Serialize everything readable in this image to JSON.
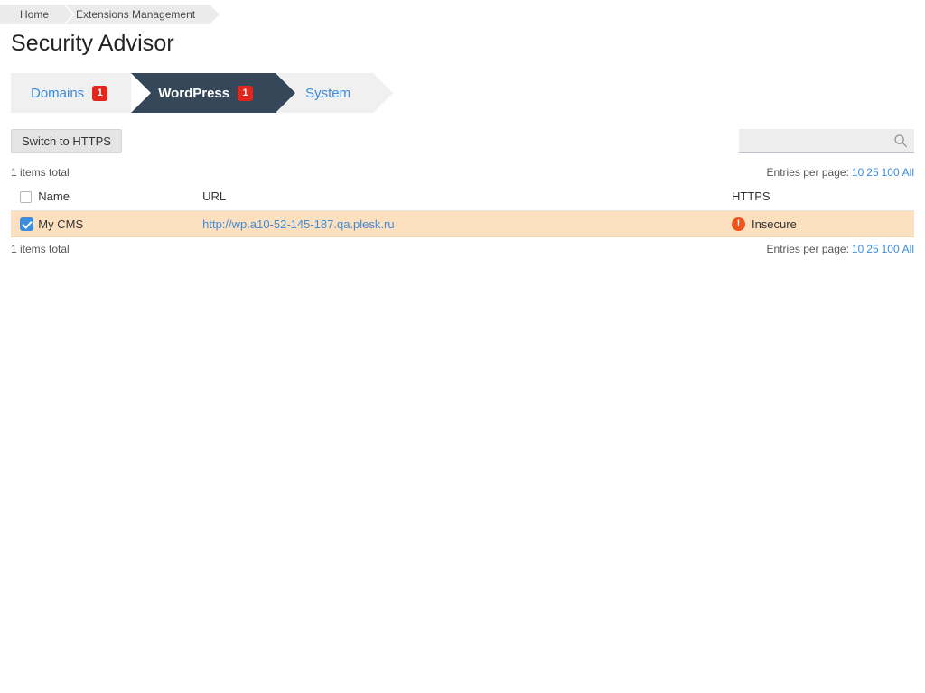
{
  "breadcrumb": {
    "items": [
      {
        "label": "Home"
      },
      {
        "label": "Extensions Management"
      }
    ]
  },
  "page": {
    "title": "Security Advisor"
  },
  "tabs": [
    {
      "label": "Domains",
      "badge": "1",
      "active": false
    },
    {
      "label": "WordPress",
      "badge": "1",
      "active": true
    },
    {
      "label": "System",
      "badge": "",
      "active": false
    }
  ],
  "toolbar": {
    "switch_https_label": "Switch to HTTPS",
    "search_placeholder": "",
    "search_value": "",
    "search_icon": "search-icon"
  },
  "pager": {
    "items_total": "1 items total",
    "entries_label": "Entries per page:",
    "options": [
      "10",
      "25",
      "100",
      "All"
    ]
  },
  "table": {
    "columns": {
      "name": "Name",
      "url": "URL",
      "https": "HTTPS"
    },
    "rows": [
      {
        "checked": true,
        "name": "My CMS",
        "url": "http://wp.a10-52-145-187.qa.plesk.ru",
        "https_status": "Insecure",
        "https_icon": "alert-icon"
      }
    ]
  },
  "colors": {
    "accent_link": "#3c8ddb",
    "active_tab_bg": "#37475a",
    "badge_red": "#e0261d",
    "row_highlight": "#fce0c0",
    "alert_orange": "#f0521c"
  }
}
